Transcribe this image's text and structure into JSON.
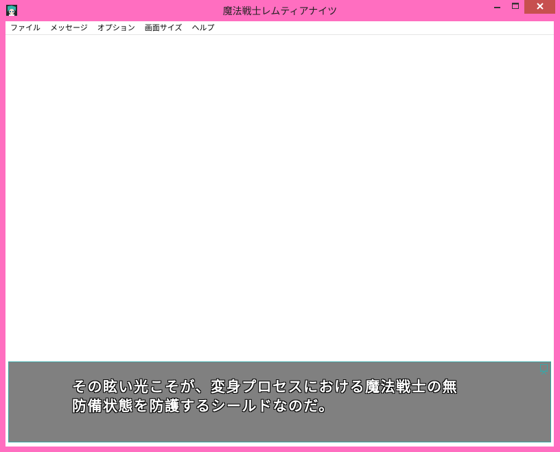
{
  "window": {
    "title": "魔法戦士レムティアナイツ",
    "frame_color": "#ff6ec0",
    "close_color": "#c7504f"
  },
  "menu": {
    "items": [
      "ファイル",
      "メッセージ",
      "オプション",
      "画面サイズ",
      "ヘルプ"
    ]
  },
  "message": {
    "line1": "その眩い光こそが、変身プロセスにおける魔法戦士の無",
    "line2": "防備状態を防護するシールドなのだ。",
    "box_color": "#808080",
    "border_color": "#3aa6a6"
  },
  "icons": {
    "app": "app-character-icon",
    "minimize": "minimize-icon",
    "maximize": "maximize-icon",
    "close": "close-icon",
    "message_close": "message-close-icon"
  }
}
